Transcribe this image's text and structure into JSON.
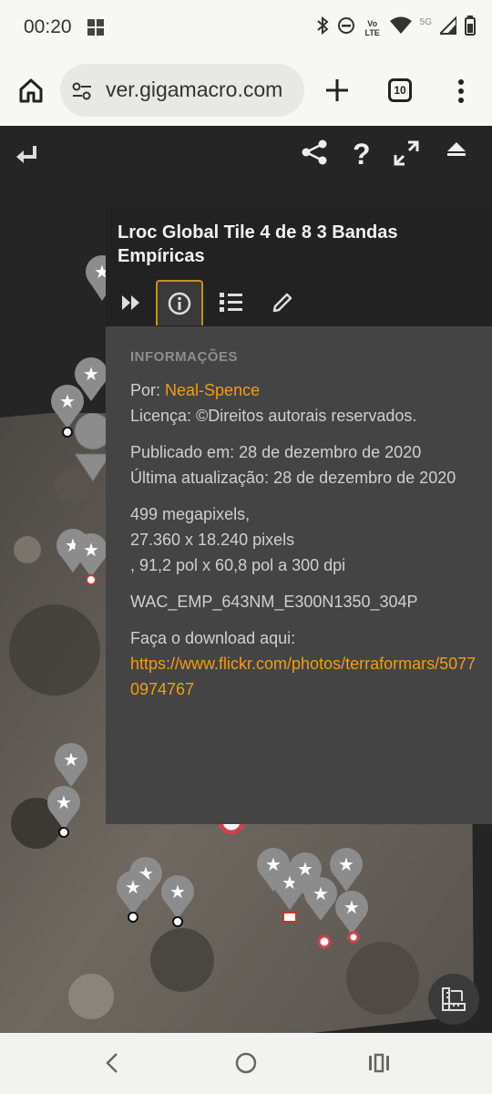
{
  "status": {
    "time": "00:20",
    "network": "5G",
    "icons": [
      "windows-logo-icon",
      "bluetooth-icon",
      "dnd-icon",
      "volte-icon",
      "wifi-icon",
      "signal-icon",
      "battery-icon"
    ],
    "volte_label": "Vo LTE"
  },
  "browser": {
    "url": "ver.gigamacro.com",
    "tab_count": "10"
  },
  "info": {
    "title": "Lroc Global Tile 4 de 8 3 Bandas Empíricas",
    "section_heading": "INFORMAÇÕES",
    "by_label": "Por:",
    "by_author": "Neal-Spence",
    "license": "Licença: ©Direitos autorais reservados.",
    "published": "Publicado em: 28 de dezembro de 2020",
    "updated": "Última atualização: 28 de dezembro de 2020",
    "megapixels": "499 megapixels,",
    "pixels": "27.360 x 18.240 pixels",
    "print_size": ", 91,2 pol x 60,8 pol a 300 dpi",
    "code": "WAC_EMP_643NM_E300N1350_304P",
    "download_label": "Faça o download aqui:",
    "download_url": "https://www.flickr.com/photos/terraformars/50770974767"
  },
  "colors": {
    "accent": "#f39c12",
    "panel": "#444444",
    "header": "#222222",
    "tab_border": "#c6901c"
  }
}
